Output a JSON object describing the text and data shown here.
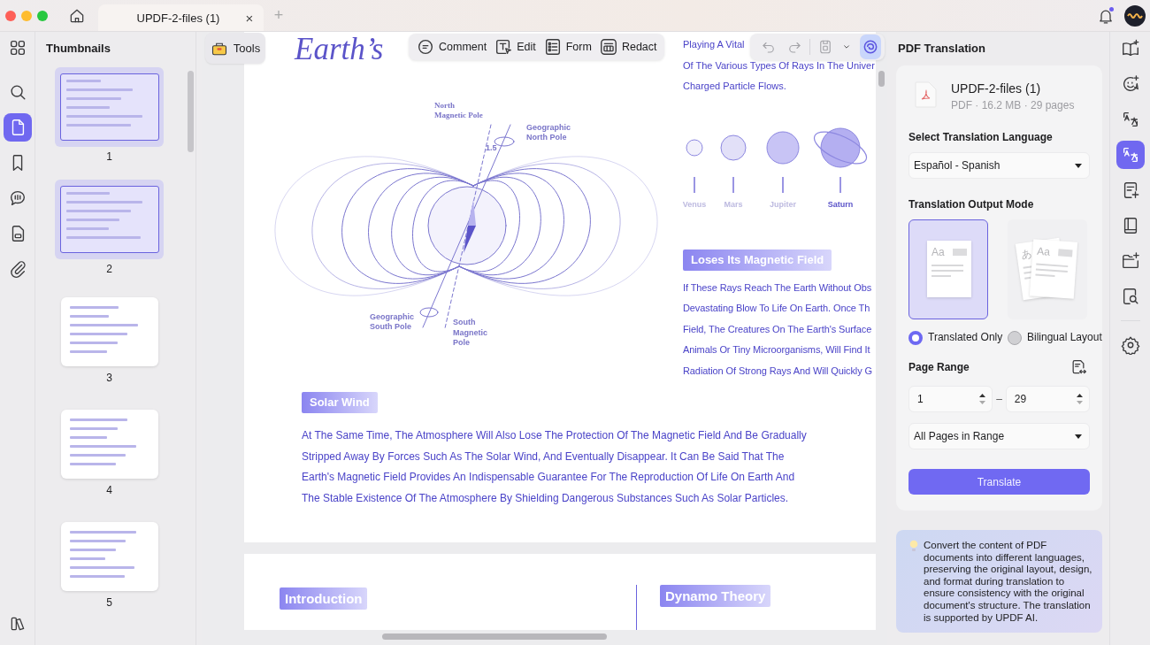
{
  "tab": {
    "title": "UPDF-2-files (1)",
    "close": "×",
    "new_tab": "+"
  },
  "left_rail": [
    {
      "kind": "grid",
      "selected": false
    },
    {
      "kind": "search",
      "selected": false
    },
    {
      "kind": "page",
      "selected": true
    },
    {
      "kind": "bookmark",
      "selected": false
    },
    {
      "kind": "comment",
      "selected": false
    },
    {
      "kind": "form",
      "selected": false
    },
    {
      "kind": "attachment",
      "selected": false
    }
  ],
  "thumbnails": {
    "title": "Thumbnails",
    "pages": [
      {
        "label": "1",
        "selected": true
      },
      {
        "label": "2",
        "selected": true
      },
      {
        "label": "3",
        "selected": false
      },
      {
        "label": "4",
        "selected": false
      },
      {
        "label": "5",
        "selected": false
      }
    ]
  },
  "toolbar": {
    "tools": "Tools",
    "actions": [
      {
        "kind": "comment",
        "label": "Comment"
      },
      {
        "kind": "edit",
        "label": "Edit"
      },
      {
        "kind": "form",
        "label": "Form"
      },
      {
        "kind": "redact",
        "label": "Redact"
      }
    ]
  },
  "document": {
    "title": "Earth’s",
    "diagram_labels": [
      {
        "lines": [
          "North",
          "Magnetic Pole"
        ]
      },
      {
        "lines": [
          "Geographic",
          "North Pole"
        ]
      },
      {
        "lines": [
          "1.5"
        ]
      },
      {
        "lines": [
          "Geographic",
          "South Pole"
        ]
      },
      {
        "lines": [
          "South",
          "Magnetic",
          "Pole"
        ]
      }
    ],
    "intro_lines": [
      "Playing A Vital",
      "Of The Various Types Of Rays In The Univer",
      "Charged Particle Flows."
    ],
    "planets": [
      {
        "name": "Venus",
        "kind": "plain",
        "color": "#f1f0fb",
        "emphasized": false
      },
      {
        "name": "Mars",
        "kind": "plain",
        "color": "#e2e0f8",
        "emphasized": false
      },
      {
        "name": "Jupiter",
        "kind": "plain",
        "color": "#c8c4f5",
        "emphasized": false
      },
      {
        "name": "Saturn",
        "kind": "ringed",
        "color": "#b4aff1",
        "emphasized": true
      }
    ],
    "heading_1": "Loses Its Magnetic Field",
    "lines_1": [
      "If These Rays Reach The Earth Without Obs",
      "Devastating Blow To Life On Earth. Once Th",
      "Field, The Creatures On The Earth's Surface",
      "Animals Or Tiny Microorganisms, Will Find It",
      "Radiation Of Strong Rays And Will Quickly G"
    ],
    "heading_2": "Solar Wind",
    "paragraph_lines": [
      "At The Same Time, The Atmosphere Will Also Lose The Protection Of The Magnetic Field And Be Gradually",
      "Stripped Away By Forces Such As The Solar Wind, And Eventually Disappear. It Can Be Said That The",
      "Earth's Magnetic Field Provides An Indispensable Guarantee For The Reproduction Of Life On Earth And",
      "The Stable Existence Of The Atmosphere By Shielding Dangerous Substances Such As Solar Particles."
    ],
    "page2": {
      "heading_left": "Introduction",
      "heading_right": "Dynamo Theory"
    }
  },
  "translation": {
    "title": "PDF Translation",
    "file": {
      "name": "UPDF-2-files (1)",
      "meta": "PDF · 16.2 MB · 29 pages"
    },
    "language_label": "Select Translation Language",
    "language": "Español - Spanish",
    "mode_label": "Translation Output Mode",
    "modes": [
      {
        "kind": "translated",
        "label": "Translated Only",
        "glyphs": [
          "Aa"
        ],
        "selected": true
      },
      {
        "kind": "bilingual",
        "label": "Bilingual Layout",
        "glyphs": [
          "あ",
          "Aa"
        ],
        "selected": false
      }
    ],
    "range_label": "Page Range",
    "range_from": "1",
    "range_separator": "–",
    "range_to": "29",
    "range_scope": "All Pages in Range",
    "button": "Translate",
    "info": "Convert the content of PDF documents into different languages, preserving the original layout, design, and format during translation to ensure consistency with the original document's structure. The translation is supported by UPDF AI."
  },
  "right_rail": [
    {
      "kind": "book-sparkle",
      "selected": false
    },
    {
      "kind": "chat-ai",
      "selected": false
    },
    {
      "kind": "translate",
      "selected": false
    },
    {
      "kind": "translate",
      "selected": true
    },
    {
      "kind": "doc-sparkle",
      "selected": false
    },
    {
      "kind": "book",
      "selected": false
    },
    {
      "kind": "folder-sparkle",
      "selected": false
    },
    {
      "kind": "search-doc",
      "selected": false
    },
    {
      "kind": "settings",
      "selected": false
    }
  ]
}
